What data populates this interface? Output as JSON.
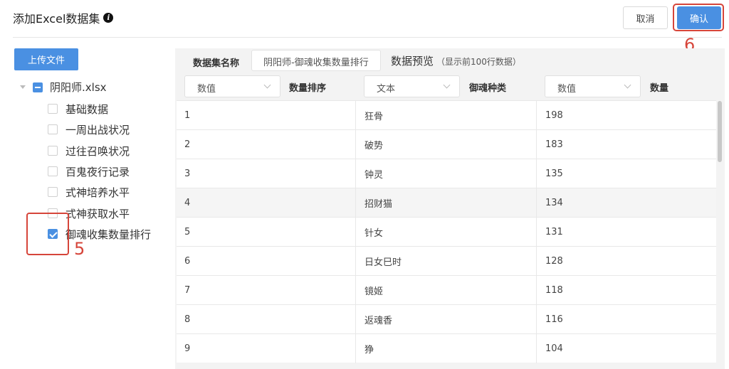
{
  "header": {
    "title": "添加Excel数据集",
    "info_icon": "i",
    "cancel_label": "取消",
    "confirm_label": "确认"
  },
  "annotations": {
    "five": "5",
    "six": "6",
    "color": "#d6453a"
  },
  "left": {
    "upload_label": "上传文件",
    "file_name": "阴阳师.xlsx",
    "sheets": [
      {
        "label": "基础数据",
        "checked": false
      },
      {
        "label": "一周出战状况",
        "checked": false
      },
      {
        "label": "过往召唤状况",
        "checked": false
      },
      {
        "label": "百鬼夜行记录",
        "checked": false
      },
      {
        "label": "式神培养水平",
        "checked": false
      },
      {
        "label": "式神获取水平",
        "checked": false
      },
      {
        "label": "御魂收集数量排行",
        "checked": true
      }
    ]
  },
  "right": {
    "dataset_name_label": "数据集名称",
    "dataset_name_value": "阴阳师-御魂收集数量排行",
    "preview_title": "数据预览",
    "preview_note": "（显示前100行数据）",
    "columns": [
      {
        "type": "数值",
        "name": "数量排序"
      },
      {
        "type": "文本",
        "name": "御魂种类"
      },
      {
        "type": "数值",
        "name": "数量"
      }
    ],
    "rows": [
      [
        "1",
        "狂骨",
        "198"
      ],
      [
        "2",
        "破势",
        "183"
      ],
      [
        "3",
        "钟灵",
        "135"
      ],
      [
        "4",
        "招财猫",
        "134"
      ],
      [
        "5",
        "针女",
        "131"
      ],
      [
        "6",
        "日女巳时",
        "128"
      ],
      [
        "7",
        "镜姬",
        "118"
      ],
      [
        "8",
        "返魂香",
        "116"
      ],
      [
        "9",
        "狰",
        "104"
      ]
    ]
  },
  "colors": {
    "accent": "#4a90e2"
  }
}
